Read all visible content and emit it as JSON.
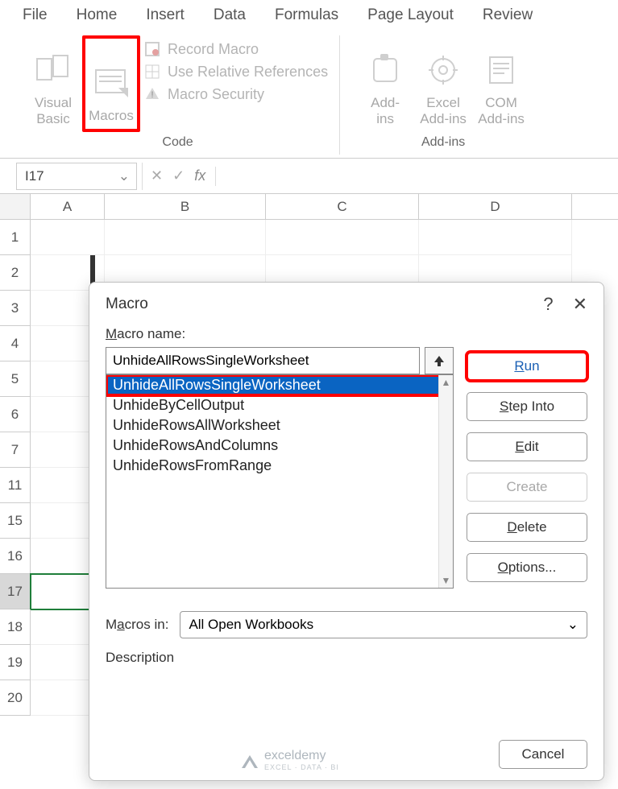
{
  "tabs": {
    "file": "File",
    "home": "Home",
    "insert": "Insert",
    "data": "Data",
    "formulas": "Formulas",
    "page_layout": "Page Layout",
    "review": "Review"
  },
  "ribbon": {
    "code_group": {
      "visual_basic": "Visual\nBasic",
      "macros": "Macros",
      "record_macro": "Record Macro",
      "use_relative": "Use Relative References",
      "macro_security": "Macro Security",
      "label": "Code"
    },
    "addins_group": {
      "addins": "Add-\nins",
      "excel_addins": "Excel\nAdd-ins",
      "com_addins": "COM\nAdd-ins",
      "label": "Add-ins"
    }
  },
  "name_box": "I17",
  "columns": [
    "A",
    "B",
    "C",
    "D"
  ],
  "row_numbers": [
    "1",
    "2",
    "3",
    "4",
    "5",
    "6",
    "7",
    "11",
    "15",
    "16",
    "17",
    "18",
    "19",
    "20"
  ],
  "dialog": {
    "title": "Macro",
    "help": "?",
    "close": "✕",
    "macro_name_label": "Macro name:",
    "macro_name_value": "UnhideAllRowsSingleWorksheet",
    "macros": [
      "UnhideAllRowsSingleWorksheet",
      "UnhideByCellOutput",
      "UnhideRowsAllWorksheet",
      "UnhideRowsAndColumns",
      "UnhideRowsFromRange"
    ],
    "macros_in_label": "Macros in:",
    "macros_in_value": "All Open Workbooks",
    "description_label": "Description",
    "buttons": {
      "run": "Run",
      "step_into": "Step Into",
      "edit": "Edit",
      "create": "Create",
      "delete": "Delete",
      "options": "Options...",
      "cancel": "Cancel"
    }
  },
  "watermark": {
    "name": "exceldemy",
    "sub": "EXCEL · DATA · BI"
  }
}
